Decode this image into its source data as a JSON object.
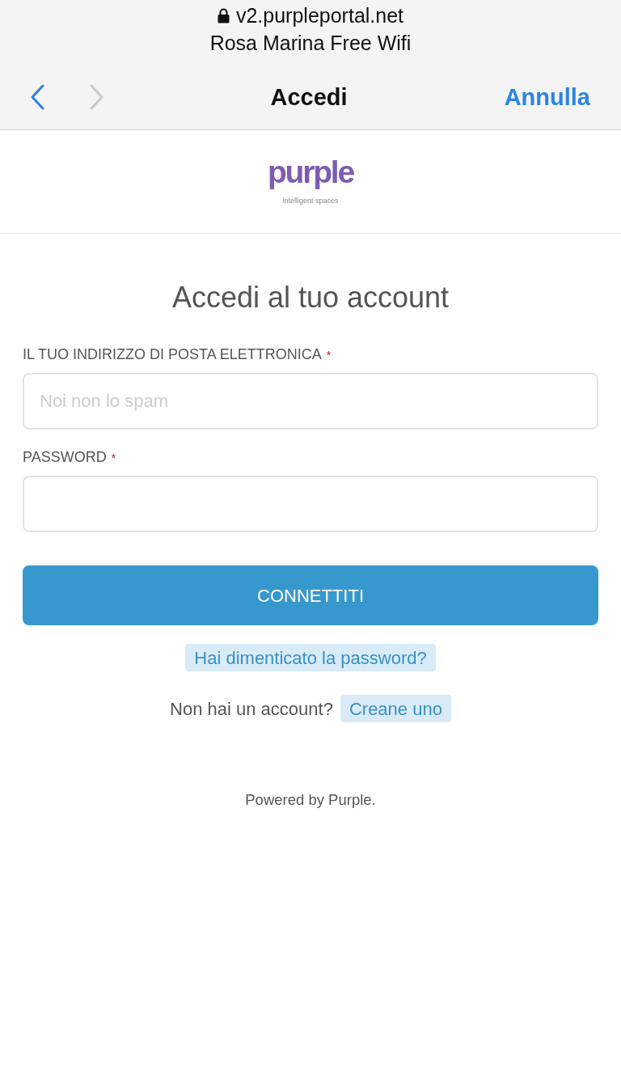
{
  "browser_bar": {
    "secure": true,
    "url": "v2.purpleportal.net",
    "page_title": "Rosa Marina Free Wifi"
  },
  "nav_bar": {
    "back_enabled": true,
    "forward_enabled": false,
    "title": "Accedi",
    "cancel": "Annulla"
  },
  "logo": {
    "wordmark": "purple",
    "tagline": "intelligent spaces"
  },
  "form": {
    "heading": "Accedi al tuo account",
    "fields": [
      {
        "label": "IL TUO INDIRIZZO DI POSTA ELETTRONICA",
        "required_mark": "*",
        "placeholder": "Noi non lo spam"
      },
      {
        "label": "PASSWORD",
        "required_mark": "*"
      }
    ],
    "submit": "CONNETTITI",
    "forgot_link": "Hai dimenticato la password?",
    "signup_prompt": "Non hai un account?",
    "signup_link": "Creane uno"
  },
  "footer": "Powered by Purple."
}
